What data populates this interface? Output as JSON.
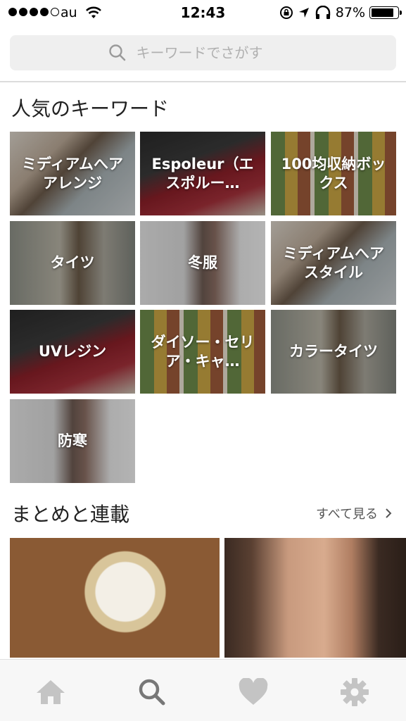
{
  "status_bar": {
    "carrier": "au",
    "time": "12:43",
    "battery": "87%",
    "battery_level": 0.87
  },
  "search": {
    "placeholder": "キーワードでさがす",
    "icon": "search-icon"
  },
  "popular_keywords": {
    "title": "人気のキーワード",
    "items": [
      {
        "label": "ミディアムへアアレンジ"
      },
      {
        "label": "Espoleur（エスポルー…"
      },
      {
        "label": "100均収納ボックス"
      },
      {
        "label": "タイツ"
      },
      {
        "label": "冬服"
      },
      {
        "label": "ミディアムへアスタイル"
      },
      {
        "label": "UVレジン"
      },
      {
        "label": "ダイソー・セリア・キャ…"
      },
      {
        "label": "カラータイツ"
      },
      {
        "label": "防寒"
      }
    ]
  },
  "series": {
    "title": "まとめと連載",
    "see_all": "すべて見る"
  },
  "tabbar": {
    "tabs": [
      {
        "icon": "home-icon"
      },
      {
        "icon": "search-icon",
        "active": true
      },
      {
        "icon": "heart-icon"
      },
      {
        "icon": "gear-icon"
      }
    ]
  },
  "colors": {
    "accent": "#777777",
    "inactive_tab": "#c4c4c4"
  }
}
